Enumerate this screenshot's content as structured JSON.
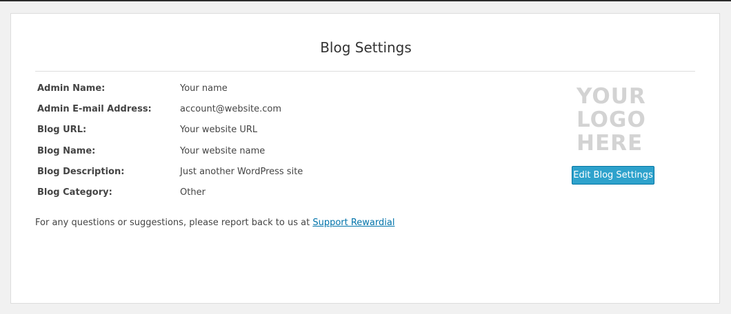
{
  "page": {
    "title": "Blog Settings"
  },
  "settings": [
    {
      "label": "Admin Name:",
      "value": "Your name"
    },
    {
      "label": "Admin E-mail Address:",
      "value": "account@website.com"
    },
    {
      "label": "Blog URL:",
      "value": "Your website URL"
    },
    {
      "label": "Blog Name:",
      "value": "Your website name"
    },
    {
      "label": "Blog Description:",
      "value": "Just another WordPress site"
    },
    {
      "label": "Blog Category:",
      "value": "Other"
    }
  ],
  "footer": {
    "text": "For any questions or suggestions, please report back to us at ",
    "link_label": "Support Rewardial"
  },
  "logo": {
    "line1": "YOUR",
    "line2": "LOGO",
    "line3": "HERE"
  },
  "actions": {
    "edit_label": "Edit Blog Settings"
  },
  "colors": {
    "accent": "#2ea2cc",
    "link": "#0073aa",
    "logo_placeholder": "#d3d3d3"
  }
}
